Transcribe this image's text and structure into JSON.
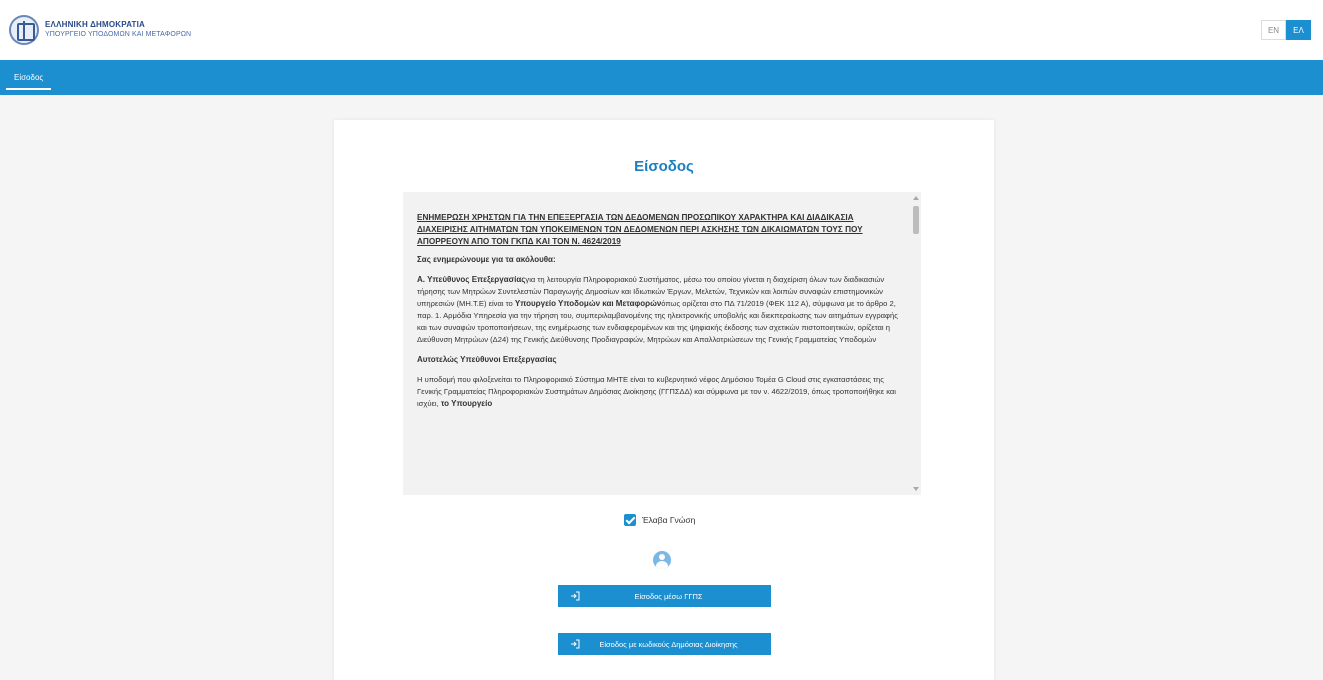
{
  "header": {
    "logo_line1": "ΕΛΛΗΝΙΚΗ ΔΗΜΟΚΡΑΤΙΑ",
    "logo_line2": "ΥΠΟΥΡΓΕΙΟ ΥΠΟΔΟΜΩΝ ΚΑΙ ΜΕΤΑΦΟΡΩΝ",
    "lang_en": "EN",
    "lang_el": "ΕΛ"
  },
  "nav": {
    "items": [
      {
        "label": "Είσοδος"
      }
    ]
  },
  "login": {
    "title": "Είσοδος",
    "terms": {
      "heading": "ΕΝΗΜΕΡΩΣΗ ΧΡΗΣΤΩΝ ΓΙΑ ΤΗΝ ΕΠΕΞΕΡΓΑΣΙΑ ΤΩΝ ΔΕΔΟΜΕΝΩΝ ΠΡΟΣΩΠΙΚΟΥ ΧΑΡΑΚΤΗΡΑ ΚΑΙ ΔΙΑΔΙΚΑΣΙΑ ΔΙΑΧΕΙΡΙΣΗΣ ΑΙΤΗΜΑΤΩΝ ΤΩΝ ΥΠΟΚΕΙΜΕΝΩΝ ΤΩΝ ΔΕΔΟΜΕΝΩΝ ΠΕΡΙ ΑΣΚΗΣΗΣ ΤΩΝ ΔΙΚΑΙΩΜΑΤΩΝ ΤΟΥΣ ΠΟΥ ΑΠΟΡΡΕΟΥΝ ΑΠΟ ΤΟΝ ΓΚΠΔ ΚΑΙ ΤΟΝ Ν. 4624/2019",
      "subheading": "Σας ενημερώνουμε για τα ακόλουθα:",
      "p1_bold": "Α. Υπεύθυνος Επεξεργασίας",
      "p1_text": "για τη λειτουργία Πληροφοριακού Συστήματος, μέσω του οποίου γίνεται η διαχείριση όλων των διαδικασιών τήρησης των Μητρώων Συντελεστών Παραγωγής Δημοσίων και Ιδιωτικών Έργων, Μελετών, Τεχνικών και λοιπών συναφών επιστημονικών υπηρεσιών (ΜΗ.Τ.Ε) είναι το ",
      "p1_bold2": "Υπουργείο Υποδομών και Μεταφορών",
      "p1_text2": "όπως ορίζεται στο ΠΔ 71/2019 (ΦΕΚ 112 Α), σύμφωνα με το άρθρο 2, παρ. 1. Αρμόδια Υπηρεσία για την τήρηση του, συμπεριλαμβανομένης της ηλεκτρονικής υποβολής και διεκπεραίωσης των αιτημάτων εγγραφής και των συναφών τροποποιήσεων, της ενημέρωσης των ενδιαφερομένων και της ψηφιακής έκδοσης των σχετικών πιστοποιητικών, ορίζεται η Διεύθυνση Μητρώων (Δ24) της Γενικής Διεύθυνσης Προδιαγραφών, Μητρώων και Απαλλοτριώσεων της Γενικής Γραμματείας Υποδομών",
      "p2_heading": "Αυτοτελώς Υπεύθυνοι Επεξεργασίας",
      "p2_text": "Η υποδομή που φιλοξενείται το Πληροφοριακό Σύστημα ΜΗΤΕ είναι το κυβερνητικό νέφος Δημόσιου Τομέα G Cloud στις εγκαταστάσεις της Γενικής Γραμματείας Πληροφοριακών Συστημάτων Δημόσιας Διοίκησης (ΓΓΠΣΔΔ) και σύμφωνα με τον ν. 4622/2019, όπως τροποποιήθηκε και ισχύει, ",
      "p2_bold": "το Υπουργείο"
    },
    "accept_label": "Έλαβα Γνώση",
    "btn_gsis": "Είσοδος μέσω ΓΓΠΣ",
    "btn_taxisnet": "Είσοδος με κωδικούς Δημόσιας Διοίκησης"
  },
  "colors": {
    "primary": "#1b8fd0",
    "title": "#1b7fc0"
  }
}
